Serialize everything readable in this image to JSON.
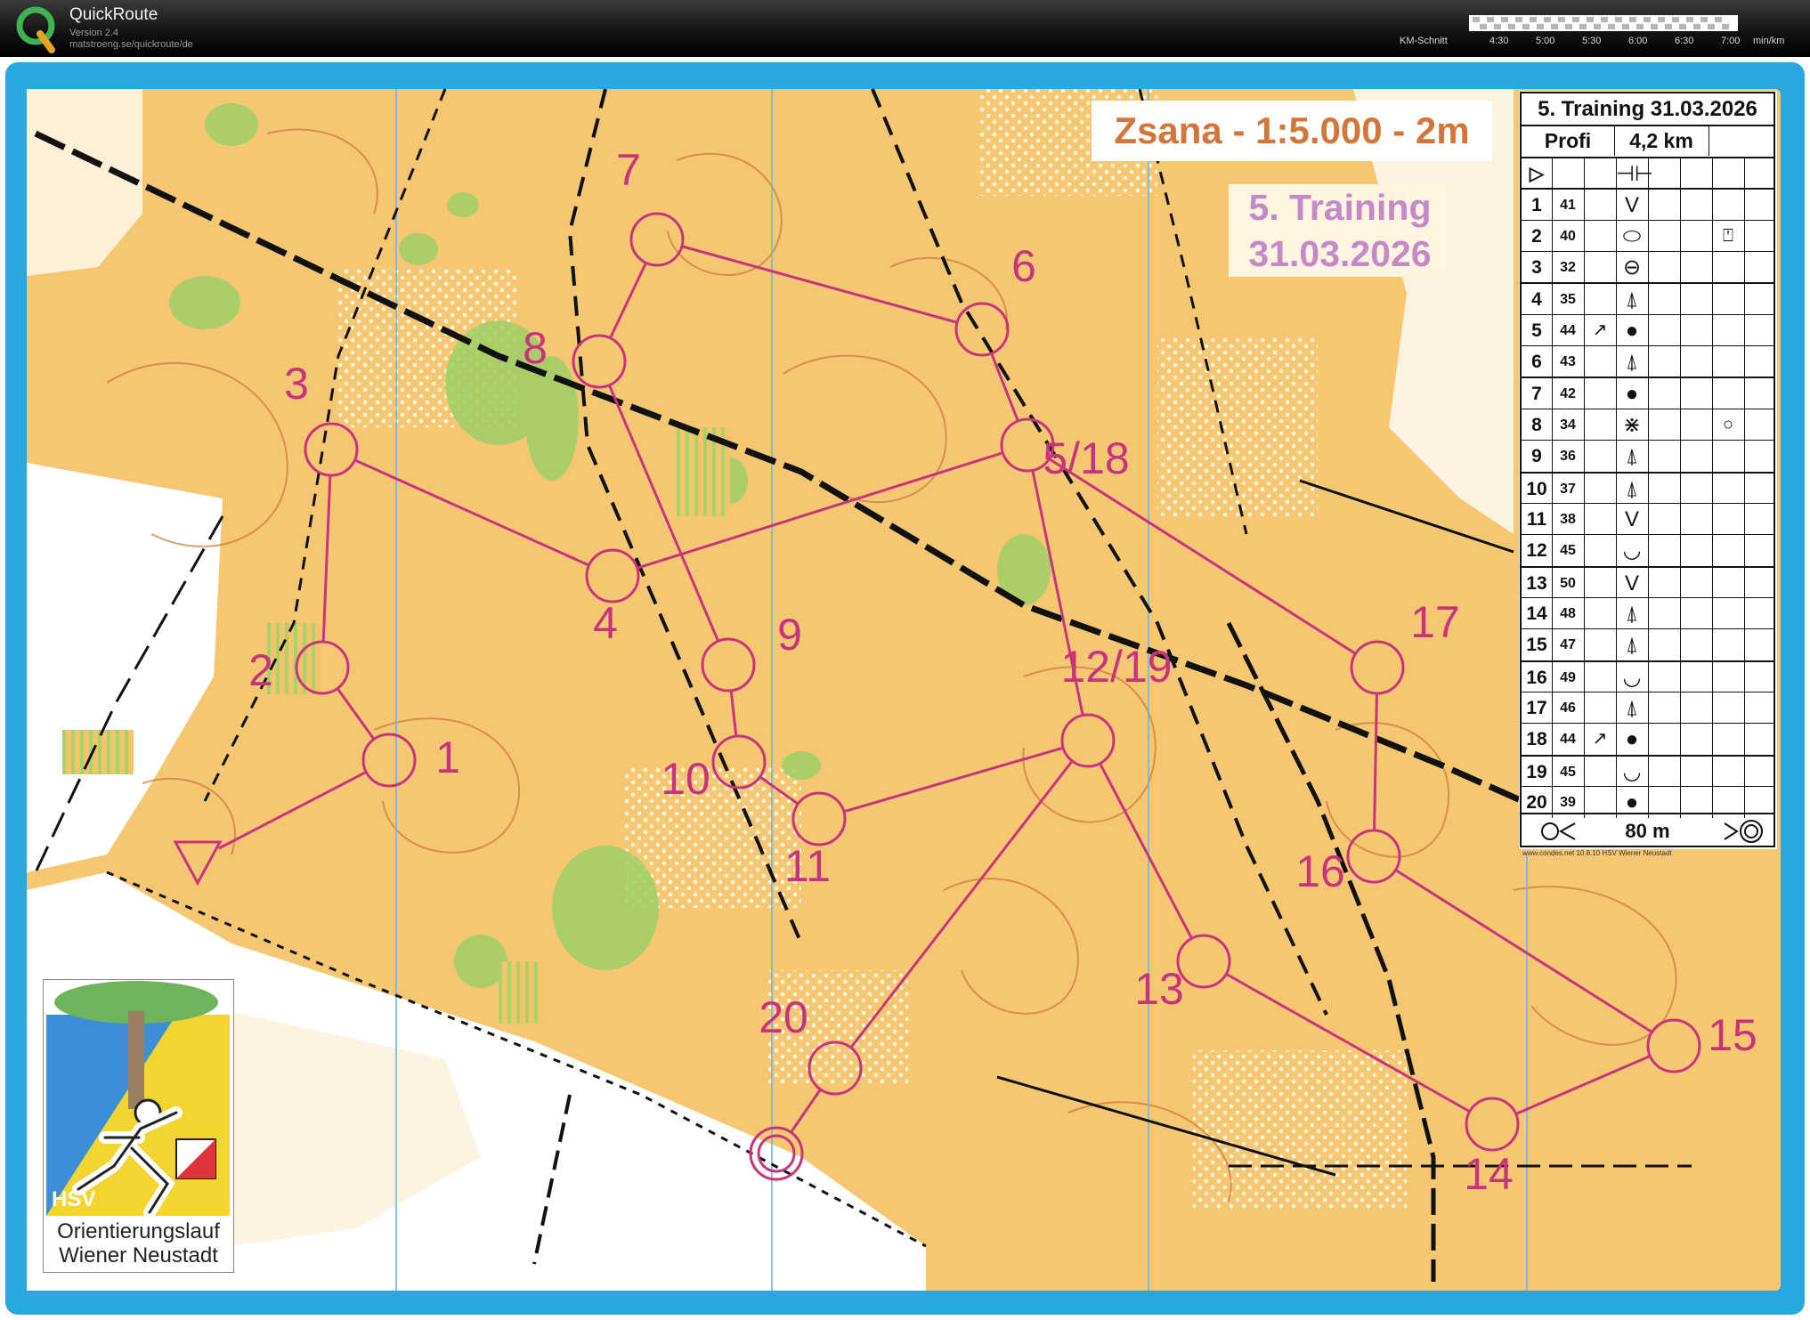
{
  "app": {
    "title": "QuickRoute",
    "version": "Version 2.4",
    "url": "matstroeng.se/quickroute/de"
  },
  "pace_legend": {
    "label": "KM-Schnitt",
    "ticks": [
      "4:30",
      "5:00",
      "5:30",
      "6:00",
      "6:30",
      "7:00"
    ],
    "unit": "min/km"
  },
  "map": {
    "title": "Zsana - 1:5.000 - 2m",
    "training_line1": "5. Training",
    "training_line2": "31.03.2026",
    "course_color": "#c8347c",
    "terrain_color": "#f5c36a",
    "start_label": "",
    "controls": [
      {
        "label": "1"
      },
      {
        "label": "2"
      },
      {
        "label": "3"
      },
      {
        "label": "4"
      },
      {
        "label": "5/18"
      },
      {
        "label": "6"
      },
      {
        "label": "7"
      },
      {
        "label": "8"
      },
      {
        "label": "9"
      },
      {
        "label": "10"
      },
      {
        "label": "11"
      },
      {
        "label": "12/19"
      },
      {
        "label": "13"
      },
      {
        "label": "14"
      },
      {
        "label": "15"
      },
      {
        "label": "16"
      },
      {
        "label": "17"
      },
      {
        "label": "20"
      }
    ]
  },
  "control_descriptions": {
    "title": "5. Training 31.03.2026",
    "class": "Profi",
    "length": "4,2 km",
    "start_symbol": "⊣⊢",
    "rows": [
      {
        "num": "1",
        "code": "41",
        "feature": "V"
      },
      {
        "num": "2",
        "code": "40",
        "feature": "⬭"
      },
      {
        "num": "3",
        "code": "32",
        "feature": "⊖"
      },
      {
        "num": "4",
        "code": "35",
        "feature": "⍋"
      },
      {
        "num": "5",
        "code": "44",
        "feature": "●"
      },
      {
        "num": "6",
        "code": "43",
        "feature": "⍋"
      },
      {
        "num": "7",
        "code": "42",
        "feature": "●"
      },
      {
        "num": "8",
        "code": "34",
        "feature": "⋇"
      },
      {
        "num": "9",
        "code": "36",
        "feature": "⍋"
      },
      {
        "num": "10",
        "code": "37",
        "feature": "⍋"
      },
      {
        "num": "11",
        "code": "38",
        "feature": "V"
      },
      {
        "num": "12",
        "code": "45",
        "feature": "◡"
      },
      {
        "num": "13",
        "code": "50",
        "feature": "V"
      },
      {
        "num": "14",
        "code": "48",
        "feature": "⍋"
      },
      {
        "num": "15",
        "code": "47",
        "feature": "⍋"
      },
      {
        "num": "16",
        "code": "49",
        "feature": "◡"
      },
      {
        "num": "17",
        "code": "46",
        "feature": "⍋"
      },
      {
        "num": "18",
        "code": "44",
        "feature": "●"
      },
      {
        "num": "19",
        "code": "45",
        "feature": "◡"
      },
      {
        "num": "20",
        "code": "39",
        "feature": "●"
      }
    ],
    "finish_distance": "80 m",
    "footer": "www.condes.net 10.8.10 HSV Wiener Neustadt"
  },
  "club": {
    "abbr": "HSV",
    "line1": "Orientierungslauf",
    "line2": "Wiener Neustadt"
  }
}
